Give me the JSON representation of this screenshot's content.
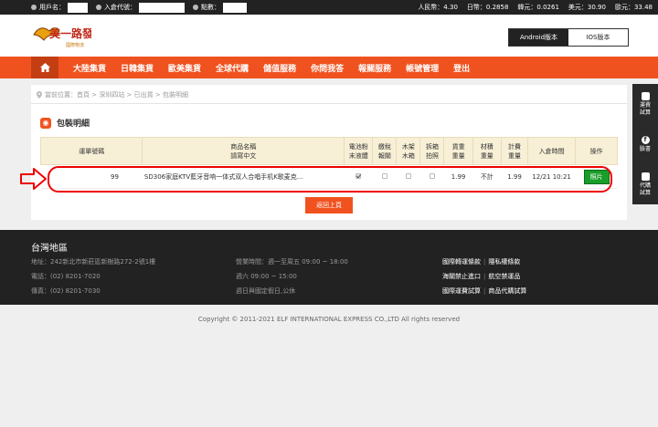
{
  "topbar": {
    "user_label": "用戶名：",
    "warehouse_label": "入倉代號：",
    "points_label": "點數：",
    "rates": [
      "人民幣：4.30",
      "日幣：0.2858",
      "韓元：0.0261",
      "美元：30.90",
      "歐元：33.48"
    ]
  },
  "header": {
    "logo_text": "美一路發",
    "logo_sub": "國際物流",
    "android_label": "Android版本",
    "ios_label": "IOS版本"
  },
  "nav": {
    "items": [
      "大陸集貨",
      "日韓集貨",
      "歐美集貨",
      "全球代購",
      "儲值服務",
      "你問我答",
      "報關服務",
      "帳號管理",
      "登出"
    ]
  },
  "breadcrumb": "當前位置：首頁 > 深圳四站 > 已出貨 > 包裝明細",
  "section_title": "包裝明細",
  "table": {
    "headers": [
      "運單號碼",
      "商品名稱\n請寫中文",
      "電池粉\n末液體",
      "繳稅\n報關",
      "木架\n木箱",
      "拆箱\n拍照",
      "貨重\n重量",
      "材積\n重量",
      "計費\n重量",
      "入倉時間",
      "操作"
    ],
    "row": {
      "tracking": "99",
      "name": "SD306家庭KTV藍牙音响一体式双人合唱手机K歌麦克...",
      "weight": "1.99",
      "volume_weight": "不計",
      "charge_weight": "1.99",
      "time": "12/21 10:21",
      "action": "照片"
    }
  },
  "back_button": "返回上頁",
  "sidebar": [
    {
      "icon": "calculator-icon",
      "label": "運費\n試算"
    },
    {
      "icon": "facebook-icon",
      "label": "臉書"
    },
    {
      "icon": "cart-icon",
      "label": "代購\n試算"
    }
  ],
  "footer": {
    "region": "台灣地區",
    "col1": [
      "地址：242新北市新莊區新樹路272-2號1樓",
      "電話：(02) 8201-7020",
      "傳真：(02) 8201-7030"
    ],
    "col2": [
      "營業時間：週一至周五 09:00 ~ 18:00",
      "週六 09:00 ~ 15:00",
      "週日與國定假日,公休"
    ],
    "links": [
      [
        "國際轉運條款",
        "隱私權條款"
      ],
      [
        "海關禁止進口",
        "航空禁運品"
      ],
      [
        "國際運費試算",
        "商品代購試算"
      ]
    ]
  },
  "copyright": "Copyright © 2011-2021 ELF INTERNATIONAL EXPRESS CO.,LTD All rights reserved"
}
